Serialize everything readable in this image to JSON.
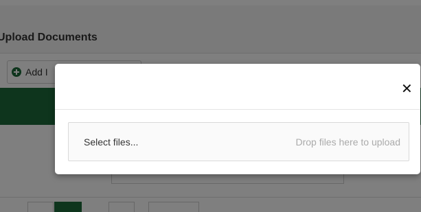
{
  "background": {
    "panel_title": "Upload Documents",
    "add_button_label": "Add I"
  },
  "modal": {
    "close_glyph": "✕",
    "select_files_label": "Select files...",
    "drop_hint": "Drop files here to upload"
  },
  "colors": {
    "brand_green": "#1d6b3a",
    "overlay": "rgba(0,0,0,0.5)"
  }
}
